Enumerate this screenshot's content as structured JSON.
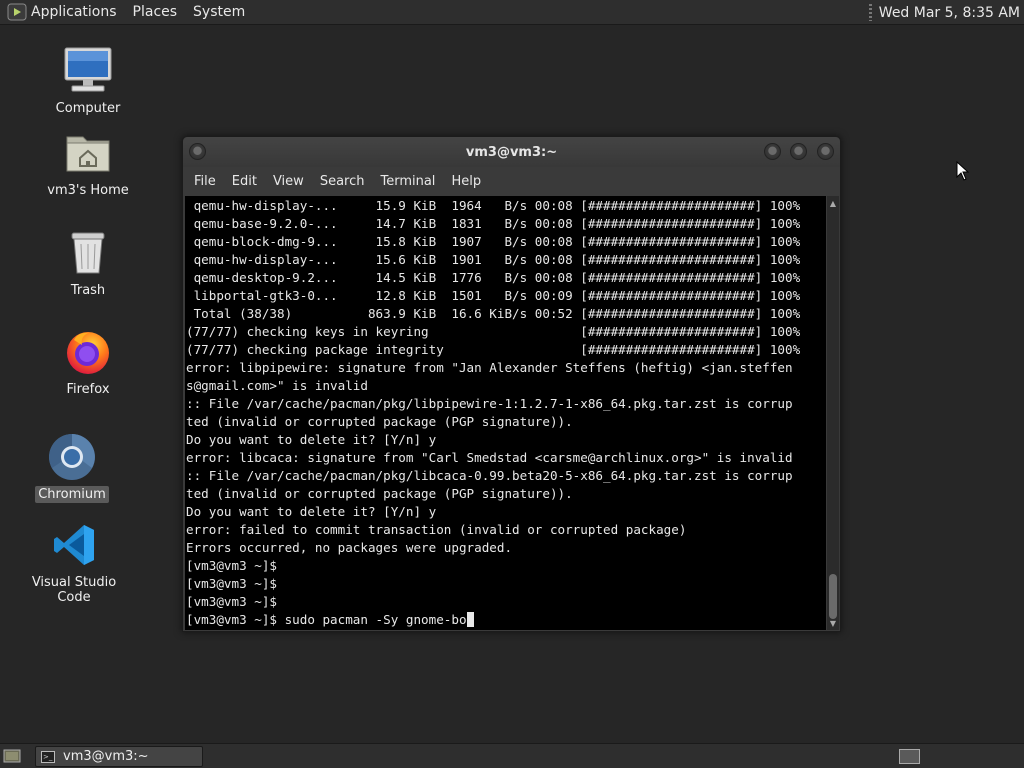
{
  "top_panel": {
    "menus": [
      "Applications",
      "Places",
      "System"
    ],
    "clock": "Wed Mar 5, 8:35 AM"
  },
  "desktop_icons": [
    {
      "label": "Computer",
      "icon": "computer-icon"
    },
    {
      "label": "vm3's Home",
      "icon": "home-folder-icon"
    },
    {
      "label": "Trash",
      "icon": "trash-icon"
    },
    {
      "label": "Firefox",
      "icon": "firefox-icon"
    },
    {
      "label": "Chromium",
      "icon": "chromium-icon"
    },
    {
      "label": "Visual Studio Code",
      "icon": "vscode-icon"
    }
  ],
  "terminal": {
    "title": "vm3@vm3:~",
    "menus": [
      "File",
      "Edit",
      "View",
      "Search",
      "Terminal",
      "Help"
    ],
    "lines": [
      " qemu-hw-display-...     15.9 KiB  1964   B/s 00:08 [######################] 100%",
      " qemu-base-9.2.0-...     14.7 KiB  1831   B/s 00:08 [######################] 100%",
      " qemu-block-dmg-9...     15.8 KiB  1907   B/s 00:08 [######################] 100%",
      " qemu-hw-display-...     15.6 KiB  1901   B/s 00:08 [######################] 100%",
      " qemu-desktop-9.2...     14.5 KiB  1776   B/s 00:08 [######################] 100%",
      " libportal-gtk3-0...     12.8 KiB  1501   B/s 00:09 [######################] 100%",
      " Total (38/38)          863.9 KiB  16.6 KiB/s 00:52 [######################] 100%",
      "(77/77) checking keys in keyring                    [######################] 100%",
      "(77/77) checking package integrity                  [######################] 100%",
      "error: libpipewire: signature from \"Jan Alexander Steffens (heftig) <jan.steffen",
      "s@gmail.com>\" is invalid",
      ":: File /var/cache/pacman/pkg/libpipewire-1:1.2.7-1-x86_64.pkg.tar.zst is corrup",
      "ted (invalid or corrupted package (PGP signature)).",
      "Do you want to delete it? [Y/n] y",
      "error: libcaca: signature from \"Carl Smedstad <carsme@archlinux.org>\" is invalid",
      ":: File /var/cache/pacman/pkg/libcaca-0.99.beta20-5-x86_64.pkg.tar.zst is corrup",
      "ted (invalid or corrupted package (PGP signature)).",
      "Do you want to delete it? [Y/n] y",
      "error: failed to commit transaction (invalid or corrupted package)",
      "Errors occurred, no packages were upgraded.",
      "[vm3@vm3 ~]$",
      "[vm3@vm3 ~]$",
      "[vm3@vm3 ~]$"
    ],
    "current_prompt": "[vm3@vm3 ~]$ sudo pacman -Sy gnome-bo"
  },
  "taskbar": {
    "window_button": "vm3@vm3:~"
  }
}
